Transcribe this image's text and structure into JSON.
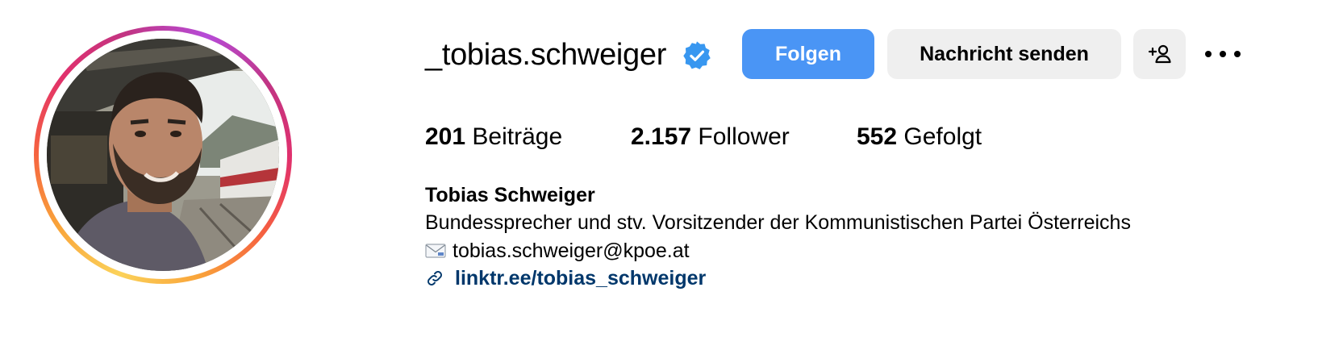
{
  "profile": {
    "username": "_tobias.schweiger",
    "verified": true,
    "buttons": {
      "follow": "Folgen",
      "message": "Nachricht senden"
    },
    "stats": {
      "posts_count": "201",
      "posts_label": "Beiträge",
      "followers_count": "2.157",
      "followers_label": "Follower",
      "following_count": "552",
      "following_label": "Gefolgt"
    },
    "full_name": "Tobias Schweiger",
    "bio": "Bundessprecher und stv. Vorsitzender der Kommunistischen Partei Österreichs",
    "email": "tobias.schweiger@kpoe.at",
    "link": "linktr.ee/tobias_schweiger"
  },
  "icons": {
    "verified": "verified-badge-icon",
    "suggest": "person-add-icon",
    "more": "more-options-icon",
    "email": "envelope-icon",
    "link": "link-icon"
  },
  "colors": {
    "follow_button": "#4a95f5",
    "secondary_button": "#efefef",
    "verified_badge": "#3897f0",
    "link_text": "#00376b"
  }
}
